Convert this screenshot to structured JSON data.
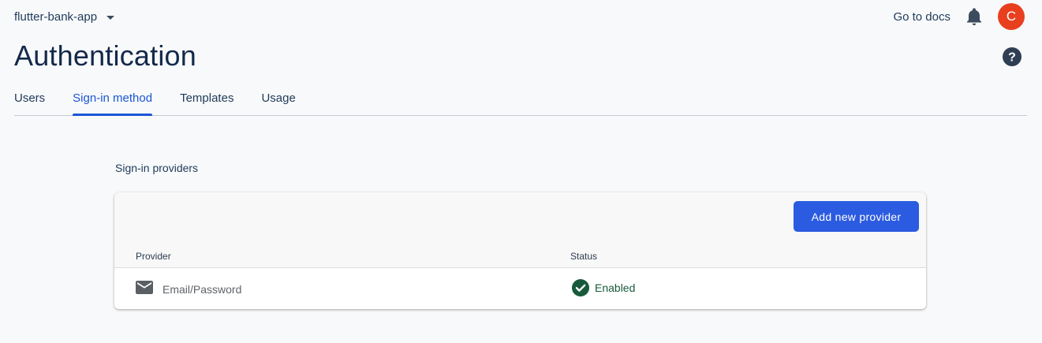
{
  "header": {
    "project_name": "flutter-bank-app",
    "docs_link": "Go to docs",
    "avatar_initial": "C",
    "avatar_color": "#e8401f"
  },
  "page": {
    "title": "Authentication"
  },
  "tabs": [
    {
      "label": "Users",
      "active": false
    },
    {
      "label": "Sign-in method",
      "active": true
    },
    {
      "label": "Templates",
      "active": false
    },
    {
      "label": "Usage",
      "active": false
    }
  ],
  "providers": {
    "heading": "Sign-in providers",
    "add_button": "Add new provider",
    "columns": {
      "provider": "Provider",
      "status": "Status"
    },
    "rows": [
      {
        "icon": "email-icon",
        "name": "Email/Password",
        "status": "Enabled",
        "status_icon": "check-circle-icon"
      }
    ]
  },
  "colors": {
    "accent": "#1a56d6",
    "button": "#2b5be0",
    "enabled": "#175a3b"
  }
}
